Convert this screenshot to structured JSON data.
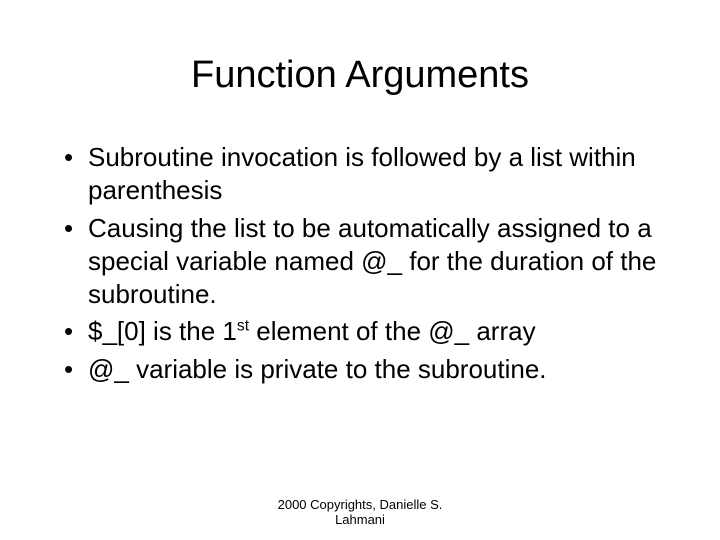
{
  "title": "Function Arguments",
  "bullets": {
    "b1": "Subroutine invocation is followed by a list within parenthesis",
    "b2": "Causing the list to be automatically assigned to a special variable named @_ for the duration of the subroutine.",
    "b3_pre": "$_[0]  is the 1",
    "b3_sup": "st",
    "b3_post": " element of the @_  array",
    "b4": "@_ variable is private to the subroutine."
  },
  "footer": {
    "line1": "2000 Copyrights, Danielle S.",
    "line2": "Lahmani"
  }
}
